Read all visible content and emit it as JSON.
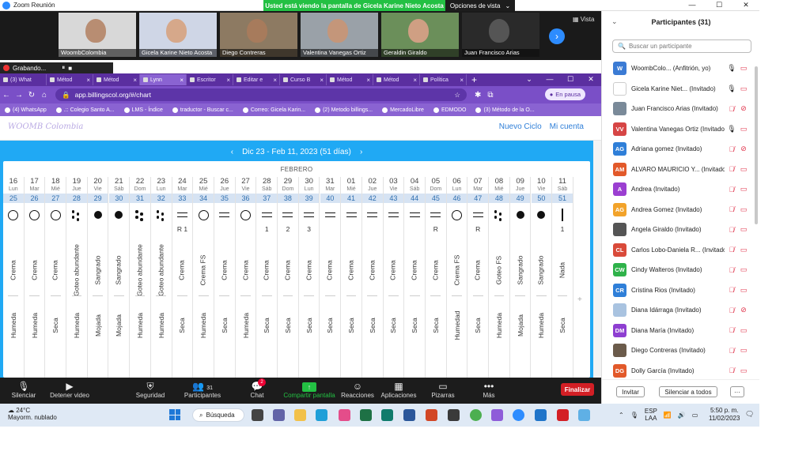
{
  "zoom": {
    "window_title": "Zoom Reunión",
    "viewing_banner": "Usted está viendo la pantalla de Gicela Karine Nieto Acosta",
    "view_options": "Opciones de vista",
    "gallery_view": "Vista",
    "recording": "Grabando...",
    "gallery": [
      "WoombColombia",
      "Gicela Karine Nieto Acosta",
      "Diego Contreras",
      "Valentina Vanegas Ortiz",
      "Geraldin Giraldo",
      "Juan Francisco Arias"
    ],
    "toolbar": {
      "mute": "Silenciar",
      "stop_video": "Detener video",
      "security": "Seguridad",
      "participants": "Participantes",
      "participants_count": "31",
      "chat": "Chat",
      "chat_badge": "2",
      "share": "Compartir pantalla",
      "reactions": "Reacciones",
      "apps": "Aplicaciones",
      "whiteboards": "Pizarras",
      "more": "Más",
      "end": "Finalizar"
    }
  },
  "browser": {
    "tabs": [
      "(3) What",
      "Métod",
      "Métod",
      "Lynn",
      "Escritor",
      "Editar e",
      "Curso B",
      "Métod",
      "Métod",
      "Política"
    ],
    "active_tab": 3,
    "url": "app.billingscol.org/#/chart",
    "pause_label": "En pausa",
    "bookmarks": [
      "(4) WhatsApp",
      ".:: Colegio Santo A...",
      "LMS - Índice",
      "traductor - Buscar c...",
      "Correo: Gicela Karin...",
      "(2) Metodo billings...",
      "MercadoLibre",
      "EDMODO",
      "(3) Método de la O..."
    ]
  },
  "site": {
    "logo": "WOOMB Colombia",
    "nav": [
      "Nuevo Ciclo",
      "Mi cuenta"
    ],
    "date_range": "Dic 23 - Feb 11, 2023 (51 días)",
    "month_label": "FEBRERO",
    "days": [
      {
        "d": "16",
        "w": "Lun",
        "c": "25",
        "s": "circle",
        "a": "",
        "desc": "Crema",
        "sens": "Humeda"
      },
      {
        "d": "17",
        "w": "Mar",
        "c": "26",
        "s": "circle",
        "a": "",
        "desc": "Crema",
        "sens": "Humeda"
      },
      {
        "d": "18",
        "w": "Mié",
        "c": "27",
        "s": "circle",
        "a": "",
        "desc": "Crema",
        "sens": "Seca"
      },
      {
        "d": "19",
        "w": "Jue",
        "c": "28",
        "s": "dots",
        "a": "",
        "desc": "Goteo abundante",
        "sens": "Humeda"
      },
      {
        "d": "20",
        "w": "Vie",
        "c": "29",
        "s": "fill",
        "a": "",
        "desc": "Sangrado",
        "sens": "Mojada"
      },
      {
        "d": "21",
        "w": "Sáb",
        "c": "30",
        "s": "fill",
        "a": "",
        "desc": "Sangrado",
        "sens": "Mojada"
      },
      {
        "d": "22",
        "w": "Dom",
        "c": "31",
        "s": "dots",
        "a": "",
        "desc": "Goteo abundante",
        "sens": "Humeda"
      },
      {
        "d": "23",
        "w": "Lun",
        "c": "32",
        "s": "dots",
        "a": "",
        "desc": "Goteo abundante",
        "sens": "Humeda"
      },
      {
        "d": "24",
        "w": "Mar",
        "c": "33",
        "s": "equal",
        "a": "R 1",
        "desc": "Crema",
        "sens": "Seca"
      },
      {
        "d": "25",
        "w": "Mié",
        "c": "34",
        "s": "circle",
        "a": "",
        "desc": "Crema FS",
        "sens": "Humeda"
      },
      {
        "d": "26",
        "w": "Jue",
        "c": "35",
        "s": "equal",
        "a": "",
        "desc": "Crema",
        "sens": "Seca"
      },
      {
        "d": "27",
        "w": "Vie",
        "c": "36",
        "s": "circle",
        "a": "",
        "desc": "Crema",
        "sens": "Humeda"
      },
      {
        "d": "28",
        "w": "Sáb",
        "c": "37",
        "s": "equal",
        "a": "1",
        "desc": "Crema",
        "sens": "Seca"
      },
      {
        "d": "29",
        "w": "Dom",
        "c": "38",
        "s": "equal",
        "a": "2",
        "desc": "Crema",
        "sens": "Seca"
      },
      {
        "d": "30",
        "w": "Lun",
        "c": "39",
        "s": "equal",
        "a": "3",
        "desc": "Crema",
        "sens": "Seca"
      },
      {
        "d": "31",
        "w": "Mar",
        "c": "40",
        "s": "equal",
        "a": "",
        "desc": "Crema",
        "sens": "Seca"
      },
      {
        "d": "01",
        "w": "Mié",
        "c": "41",
        "s": "equal",
        "a": "",
        "desc": "Crema",
        "sens": "Seca"
      },
      {
        "d": "02",
        "w": "Jue",
        "c": "42",
        "s": "equal",
        "a": "",
        "desc": "Crema",
        "sens": "Seca"
      },
      {
        "d": "03",
        "w": "Vie",
        "c": "43",
        "s": "equal",
        "a": "",
        "desc": "Crema",
        "sens": "Seca"
      },
      {
        "d": "04",
        "w": "Sáb",
        "c": "44",
        "s": "equal",
        "a": "",
        "desc": "Crema",
        "sens": "Seca"
      },
      {
        "d": "05",
        "w": "Dom",
        "c": "45",
        "s": "equal",
        "a": "R",
        "desc": "Crema",
        "sens": "Seca"
      },
      {
        "d": "06",
        "w": "Lun",
        "c": "46",
        "s": "circle",
        "a": "",
        "desc": "Crema FS",
        "sens": "Humedad"
      },
      {
        "d": "07",
        "w": "Mar",
        "c": "47",
        "s": "equal",
        "a": "R",
        "desc": "Crema",
        "sens": "Seca"
      },
      {
        "d": "08",
        "w": "Mié",
        "c": "48",
        "s": "dots",
        "a": "",
        "desc": "Goteo FS",
        "sens": "Humeda"
      },
      {
        "d": "09",
        "w": "Jue",
        "c": "49",
        "s": "fill",
        "a": "",
        "desc": "Sangrado",
        "sens": "Mojada"
      },
      {
        "d": "10",
        "w": "Vie",
        "c": "50",
        "s": "fill",
        "a": "",
        "desc": "Sangrado",
        "sens": "Humeda"
      },
      {
        "d": "11",
        "w": "Sáb",
        "c": "51",
        "s": "line",
        "a": "1",
        "desc": "Nada",
        "sens": "Seca"
      }
    ],
    "add_symbol": "+"
  },
  "participants_panel": {
    "title": "Participantes (31)",
    "search_placeholder": "Buscar un participante",
    "list": [
      {
        "init": "W",
        "color": "#3b7bd4",
        "name": "WoombColo... (Anfitrión, yo)",
        "mic": "on",
        "cam": "on"
      },
      {
        "init": "",
        "color": "#ffffff",
        "name": "Gicela Karine Niet... (Invitado)",
        "mic": "on",
        "cam": "on"
      },
      {
        "init": "",
        "color": "#7a8a99",
        "name": "Juan Francisco Arias (Invitado)",
        "mic": "off",
        "cam": "off"
      },
      {
        "init": "VV",
        "color": "#d64545",
        "name": "Valentina Vanegas Ortiz (Invitado)",
        "mic": "on",
        "cam": "on"
      },
      {
        "init": "AG",
        "color": "#2f7fd8",
        "name": "Adriana gomez (Invitado)",
        "mic": "off",
        "cam": "off"
      },
      {
        "init": "AM",
        "color": "#e2592a",
        "name": "ALVARO MAURICIO Y... (Invitado)",
        "mic": "off",
        "cam": "on"
      },
      {
        "init": "A",
        "color": "#9b3fd1",
        "name": "Andrea (Invitado)",
        "mic": "off",
        "cam": "on"
      },
      {
        "init": "AG",
        "color": "#f2a32a",
        "name": "Andrea Gomez (Invitado)",
        "mic": "off",
        "cam": "on"
      },
      {
        "init": "",
        "color": "#555555",
        "name": "Angela Giraldo (Invitado)",
        "mic": "off",
        "cam": "on"
      },
      {
        "init": "CL",
        "color": "#d94a3a",
        "name": "Carlos Lobo-Daniela R... (Invitado)",
        "mic": "off",
        "cam": "on"
      },
      {
        "init": "CW",
        "color": "#2fb24a",
        "name": "Cindy Walteros (Invitado)",
        "mic": "off",
        "cam": "on"
      },
      {
        "init": "CR",
        "color": "#2f7fd8",
        "name": "Cristina Rios (Invitado)",
        "mic": "off",
        "cam": "on"
      },
      {
        "init": "",
        "color": "#a9c3e0",
        "name": "Diana Idárraga (Invitado)",
        "mic": "off",
        "cam": "off"
      },
      {
        "init": "DM",
        "color": "#8e3fd1",
        "name": "Diana María (Invitado)",
        "mic": "off",
        "cam": "on"
      },
      {
        "init": "",
        "color": "#6b5b4b",
        "name": "Diego Contreras (Invitado)",
        "mic": "off",
        "cam": "on"
      },
      {
        "init": "DG",
        "color": "#e2592a",
        "name": "Dolly García (Invitado)",
        "mic": "off",
        "cam": "on"
      }
    ],
    "invite": "Invitar",
    "mute_all": "Silenciar a todos",
    "more": "···"
  },
  "taskbar": {
    "temp": "24°C",
    "weather": "Mayorm. nublado",
    "search": "Búsqueda",
    "lang1": "ESP",
    "lang2": "LAA",
    "time": "5:50 p. m.",
    "date": "11/02/2023"
  }
}
